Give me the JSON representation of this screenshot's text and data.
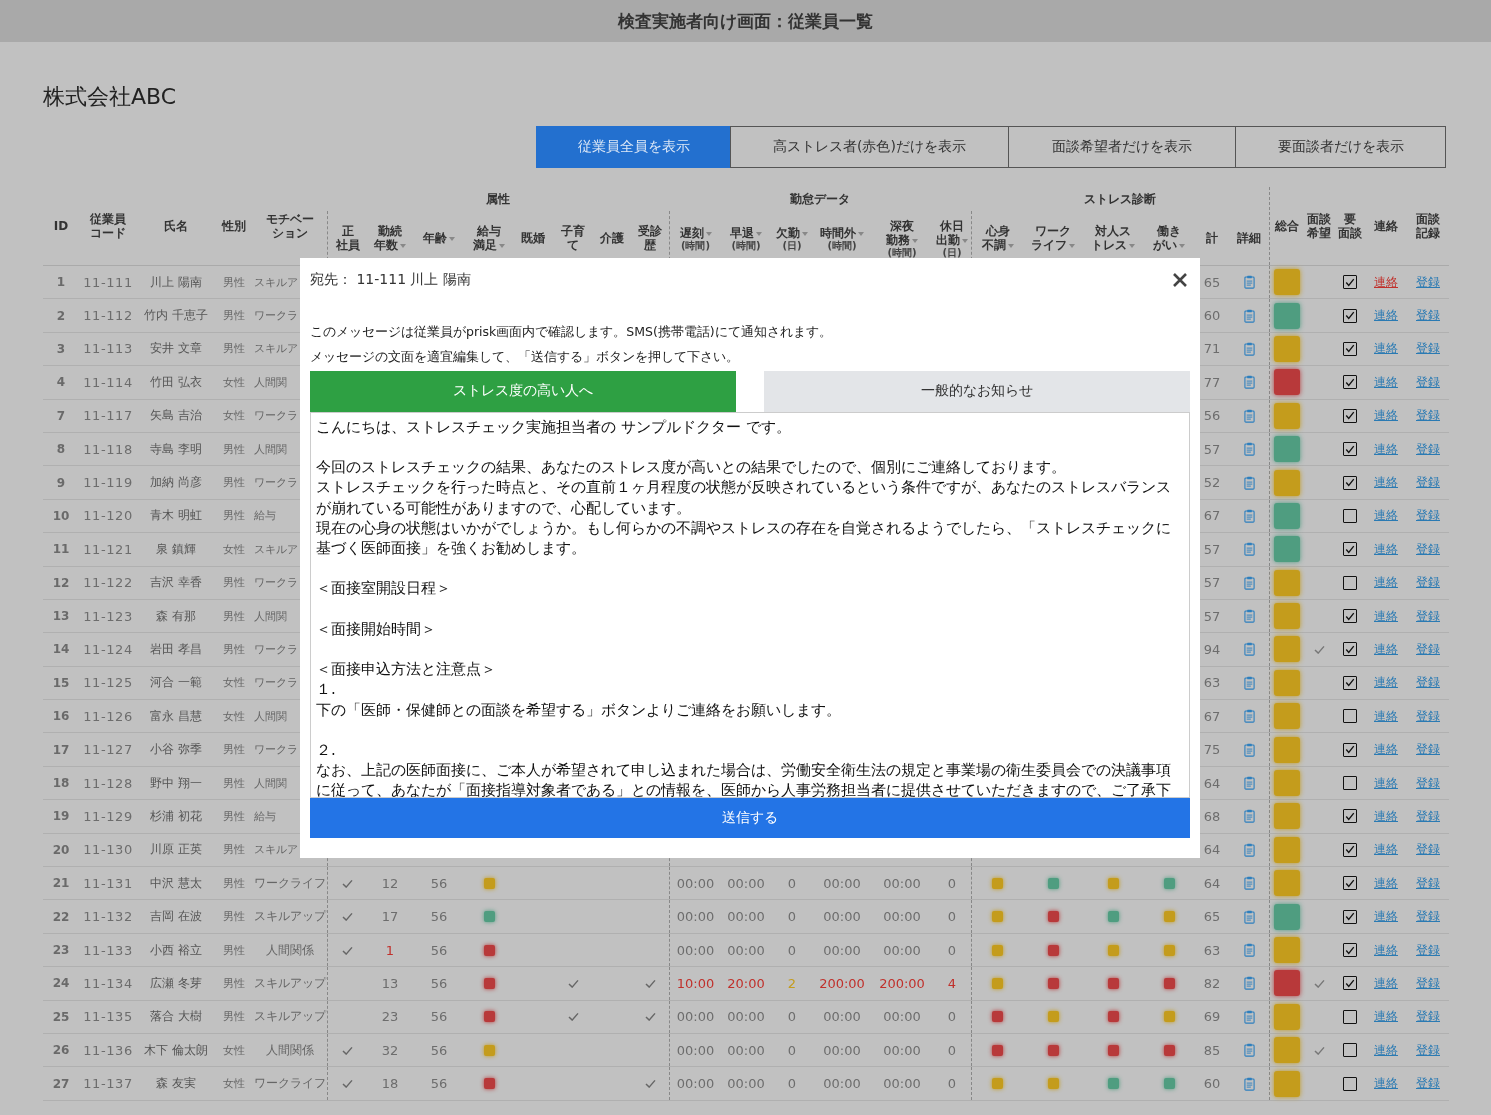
{
  "window": {
    "title": "検査実施者向け画面：従業員一覧"
  },
  "company": "株式会社ABC",
  "filters": [
    {
      "label": "従業員全員を表示",
      "selected": true
    },
    {
      "label": "高ストレス者(赤色)だけを表示",
      "selected": false
    },
    {
      "label": "面談希望者だけを表示",
      "selected": false
    },
    {
      "label": "要面談者だけを表示",
      "selected": false
    }
  ],
  "table": {
    "groups": [
      "属性",
      "勤怠データ",
      "ストレス診断"
    ],
    "columns": [
      {
        "lines": [
          "ID"
        ],
        "sortable": false
      },
      {
        "lines": [
          "従業員",
          "コード"
        ],
        "sortable": false
      },
      {
        "lines": [
          "氏名"
        ],
        "sortable": false
      },
      {
        "lines": [
          "性別"
        ],
        "sortable": false
      },
      {
        "lines": [
          "モチベー",
          "ション"
        ],
        "sortable": false
      },
      {
        "lines": [
          "正",
          "社員"
        ],
        "sortable": false
      },
      {
        "lines": [
          "勤続",
          "年数"
        ],
        "sortable": true
      },
      {
        "lines": [
          "年齢"
        ],
        "sortable": true
      },
      {
        "lines": [
          "給与",
          "満足"
        ],
        "sortable": true
      },
      {
        "lines": [
          "既婚"
        ],
        "sortable": false
      },
      {
        "lines": [
          "子育",
          "て"
        ],
        "sortable": false
      },
      {
        "lines": [
          "介護"
        ],
        "sortable": false
      },
      {
        "lines": [
          "受診",
          "歴"
        ],
        "sortable": false
      },
      {
        "lines": [
          "遅刻"
        ],
        "sortable": true,
        "unit": "(時間)"
      },
      {
        "lines": [
          "早退"
        ],
        "sortable": true,
        "unit": "(時間)"
      },
      {
        "lines": [
          "欠勤"
        ],
        "sortable": true,
        "unit": "(日)"
      },
      {
        "lines": [
          "時間外"
        ],
        "sortable": true,
        "unit": "(時間)"
      },
      {
        "lines": [
          "深夜",
          "勤務"
        ],
        "sortable": true,
        "unit": "(時間)"
      },
      {
        "lines": [
          "休日",
          "出勤"
        ],
        "sortable": true,
        "unit": "(日)"
      },
      {
        "lines": [
          "心身",
          "不調"
        ],
        "sortable": true
      },
      {
        "lines": [
          "ワーク",
          "ライフ"
        ],
        "sortable": true
      },
      {
        "lines": [
          "対人ス",
          "トレス"
        ],
        "sortable": true
      },
      {
        "lines": [
          "働き",
          "がい"
        ],
        "sortable": true
      },
      {
        "lines": [
          "計"
        ],
        "sortable": false
      },
      {
        "lines": [
          "詳細"
        ],
        "sortable": false
      },
      {
        "lines": [
          "総合"
        ],
        "sortable": false
      },
      {
        "lines": [
          "面談",
          "希望"
        ],
        "sortable": false
      },
      {
        "lines": [
          "要",
          "面談"
        ],
        "sortable": false
      },
      {
        "lines": [
          "連絡"
        ],
        "sortable": false
      },
      {
        "lines": [
          "面談",
          "記録"
        ],
        "sortable": false
      }
    ],
    "rows": [
      {
        "id": "1",
        "code": "11-111",
        "name": "川上 陽南",
        "gender": "男性",
        "motivation": "スキルア",
        "total": "65",
        "overall": {
          "color": "#c49c1c"
        },
        "interview_wish": false,
        "interview_needed": true,
        "contact": {
          "label": "連絡",
          "selected": true
        },
        "record": "登録"
      },
      {
        "id": "2",
        "code": "11-112",
        "name": "竹内 千恵子",
        "gender": "男性",
        "motivation": "ワークラ",
        "total": "60",
        "overall": {
          "color": "#4f9d80"
        },
        "interview_wish": false,
        "interview_needed": true,
        "contact": {
          "label": "連絡",
          "selected": false
        },
        "record": "登録"
      },
      {
        "id": "3",
        "code": "11-113",
        "name": "安井 文章",
        "gender": "男性",
        "motivation": "スキルア",
        "total": "71",
        "overall": {
          "color": "#c49c1c"
        },
        "interview_wish": false,
        "interview_needed": true,
        "contact": {
          "label": "連絡",
          "selected": false
        },
        "record": "登録"
      },
      {
        "id": "4",
        "code": "11-114",
        "name": "竹田 弘衣",
        "gender": "女性",
        "motivation": "人間関",
        "total": "77",
        "overall": {
          "color": "#b8393a"
        },
        "interview_wish": false,
        "interview_needed": true,
        "contact": {
          "label": "連絡",
          "selected": false
        },
        "record": "登録"
      },
      {
        "id": "7",
        "code": "11-117",
        "name": "矢島 吉治",
        "gender": "女性",
        "motivation": "ワークラ",
        "total": "56",
        "overall": {
          "color": "#c49c1c"
        },
        "interview_wish": false,
        "interview_needed": true,
        "contact": {
          "label": "連絡",
          "selected": false
        },
        "record": "登録"
      },
      {
        "id": "8",
        "code": "11-118",
        "name": "寺島 李明",
        "gender": "男性",
        "motivation": "人間関",
        "total": "57",
        "overall": {
          "color": "#4f9d80"
        },
        "interview_wish": false,
        "interview_needed": true,
        "contact": {
          "label": "連絡",
          "selected": false
        },
        "record": "登録"
      },
      {
        "id": "9",
        "code": "11-119",
        "name": "加納 尚彦",
        "gender": "男性",
        "motivation": "ワークラ",
        "total": "52",
        "overall": {
          "color": "#c49c1c"
        },
        "interview_wish": false,
        "interview_needed": true,
        "contact": {
          "label": "連絡",
          "selected": false
        },
        "record": "登録"
      },
      {
        "id": "10",
        "code": "11-120",
        "name": "青木 明虹",
        "gender": "男性",
        "motivation": "給与",
        "total": "67",
        "overall": {
          "color": "#4f9d80"
        },
        "interview_wish": false,
        "interview_needed": false,
        "contact": {
          "label": "連絡",
          "selected": false
        },
        "record": "登録"
      },
      {
        "id": "11",
        "code": "11-121",
        "name": "泉 鎮輝",
        "gender": "女性",
        "motivation": "スキルア",
        "total": "57",
        "overall": {
          "color": "#4f9d80"
        },
        "interview_wish": false,
        "interview_needed": true,
        "contact": {
          "label": "連絡",
          "selected": false
        },
        "record": "登録"
      },
      {
        "id": "12",
        "code": "11-122",
        "name": "吉沢 幸香",
        "gender": "男性",
        "motivation": "ワークラ",
        "total": "57",
        "overall": {
          "color": "#c49c1c"
        },
        "interview_wish": false,
        "interview_needed": false,
        "contact": {
          "label": "連絡",
          "selected": false
        },
        "record": "登録"
      },
      {
        "id": "13",
        "code": "11-123",
        "name": "森 有那",
        "gender": "男性",
        "motivation": "人間関",
        "total": "57",
        "overall": {
          "color": "#c49c1c"
        },
        "interview_wish": false,
        "interview_needed": true,
        "contact": {
          "label": "連絡",
          "selected": false
        },
        "record": "登録"
      },
      {
        "id": "14",
        "code": "11-124",
        "name": "岩田 孝昌",
        "gender": "男性",
        "motivation": "ワークラ",
        "total": "94",
        "overall": {
          "color": "#c49c1c"
        },
        "interview_wish": true,
        "interview_needed": true,
        "contact": {
          "label": "連絡",
          "selected": false
        },
        "record": "登録"
      },
      {
        "id": "15",
        "code": "11-125",
        "name": "河合 一範",
        "gender": "女性",
        "motivation": "ワークラ",
        "total": "63",
        "overall": {
          "color": "#c49c1c"
        },
        "interview_wish": false,
        "interview_needed": true,
        "contact": {
          "label": "連絡",
          "selected": false
        },
        "record": "登録"
      },
      {
        "id": "16",
        "code": "11-126",
        "name": "富永 昌慧",
        "gender": "女性",
        "motivation": "人間関",
        "total": "67",
        "overall": {
          "color": "#c49c1c"
        },
        "interview_wish": false,
        "interview_needed": false,
        "contact": {
          "label": "連絡",
          "selected": false
        },
        "record": "登録"
      },
      {
        "id": "17",
        "code": "11-127",
        "name": "小谷 弥季",
        "gender": "男性",
        "motivation": "ワークラ",
        "total": "75",
        "overall": {
          "color": "#c49c1c"
        },
        "interview_wish": false,
        "interview_needed": true,
        "contact": {
          "label": "連絡",
          "selected": false
        },
        "record": "登録"
      },
      {
        "id": "18",
        "code": "11-128",
        "name": "野中 翔一",
        "gender": "男性",
        "motivation": "人間関",
        "total": "64",
        "overall": {
          "color": "#c49c1c"
        },
        "interview_wish": false,
        "interview_needed": false,
        "contact": {
          "label": "連絡",
          "selected": false
        },
        "record": "登録"
      },
      {
        "id": "19",
        "code": "11-129",
        "name": "杉浦 初花",
        "gender": "男性",
        "motivation": "給与",
        "total": "68",
        "overall": {
          "color": "#c49c1c"
        },
        "interview_wish": false,
        "interview_needed": true,
        "contact": {
          "label": "連絡",
          "selected": false
        },
        "record": "登録"
      },
      {
        "id": "20",
        "code": "11-130",
        "name": "川原 正英",
        "gender": "男性",
        "motivation": "スキルア",
        "total": "64",
        "overall": {
          "color": "#c49c1c"
        },
        "interview_wish": false,
        "interview_needed": true,
        "contact": {
          "label": "連絡",
          "selected": false
        },
        "record": "登録"
      },
      {
        "id": "21",
        "code": "11-131",
        "name": "中沢 慧太",
        "gender": "男性",
        "motivation": "ワークライフ",
        "attributes": {
          "full_time": true,
          "tenure": {
            "text": "12",
            "color": "#6d6d6d"
          },
          "age": "56",
          "salary": {
            "color": "#c49c1c"
          },
          "married": false,
          "childcare": false,
          "care": false,
          "checkup": false
        },
        "attendance": [
          {
            "text": "00:00",
            "color": "#6d6d6d"
          },
          {
            "text": "00:00",
            "color": "#6d6d6d"
          },
          {
            "text": "0",
            "color": "#6d6d6d"
          },
          {
            "text": "00:00",
            "color": "#6d6d6d"
          },
          {
            "text": "00:00",
            "color": "#6d6d6d"
          },
          {
            "text": "0",
            "color": "#6d6d6d"
          }
        ],
        "stress": [
          {
            "color": "#c49c1c"
          },
          {
            "color": "#4f9d80"
          },
          {
            "color": "#c49c1c"
          },
          {
            "color": "#4f9d80"
          }
        ],
        "total": "64",
        "overall": {
          "color": "#c49c1c"
        },
        "interview_wish": false,
        "interview_needed": true,
        "contact": {
          "label": "連絡",
          "selected": false
        },
        "record": "登録"
      },
      {
        "id": "22",
        "code": "11-132",
        "name": "吉岡 在波",
        "gender": "男性",
        "motivation": "スキルアップ",
        "attributes": {
          "full_time": true,
          "tenure": {
            "text": "17",
            "color": "#6d6d6d"
          },
          "age": "56",
          "salary": {
            "color": "#4f9d80"
          },
          "married": false,
          "childcare": false,
          "care": false,
          "checkup": false
        },
        "attendance": [
          {
            "text": "00:00",
            "color": "#6d6d6d"
          },
          {
            "text": "00:00",
            "color": "#6d6d6d"
          },
          {
            "text": "0",
            "color": "#6d6d6d"
          },
          {
            "text": "00:00",
            "color": "#6d6d6d"
          },
          {
            "text": "00:00",
            "color": "#6d6d6d"
          },
          {
            "text": "0",
            "color": "#6d6d6d"
          }
        ],
        "stress": [
          {
            "color": "#c49c1c"
          },
          {
            "color": "#b8393a"
          },
          {
            "color": "#4f9d80"
          },
          {
            "color": "#c49c1c"
          }
        ],
        "total": "65",
        "overall": {
          "color": "#4f9d80"
        },
        "interview_wish": false,
        "interview_needed": true,
        "contact": {
          "label": "連絡",
          "selected": false
        },
        "record": "登録"
      },
      {
        "id": "23",
        "code": "11-133",
        "name": "小西 裕立",
        "gender": "男性",
        "motivation": "人間関係",
        "attributes": {
          "full_time": true,
          "tenure": {
            "text": "1",
            "color": "#c0302b"
          },
          "age": "56",
          "salary": {
            "color": "#b8393a"
          },
          "married": false,
          "childcare": false,
          "care": false,
          "checkup": false
        },
        "attendance": [
          {
            "text": "00:00",
            "color": "#6d6d6d"
          },
          {
            "text": "00:00",
            "color": "#6d6d6d"
          },
          {
            "text": "0",
            "color": "#6d6d6d"
          },
          {
            "text": "00:00",
            "color": "#6d6d6d"
          },
          {
            "text": "00:00",
            "color": "#6d6d6d"
          },
          {
            "text": "0",
            "color": "#6d6d6d"
          }
        ],
        "stress": [
          {
            "color": "#c49c1c"
          },
          {
            "color": "#b8393a"
          },
          {
            "color": "#c49c1c"
          },
          {
            "color": "#c49c1c"
          }
        ],
        "total": "63",
        "overall": {
          "color": "#c49c1c"
        },
        "interview_wish": false,
        "interview_needed": true,
        "contact": {
          "label": "連絡",
          "selected": false
        },
        "record": "登録"
      },
      {
        "id": "24",
        "code": "11-134",
        "name": "広瀬 冬芽",
        "gender": "男性",
        "motivation": "スキルアップ",
        "attributes": {
          "full_time": false,
          "tenure": {
            "text": "13",
            "color": "#6d6d6d"
          },
          "age": "56",
          "salary": {
            "color": "#b8393a"
          },
          "married": false,
          "childcare": true,
          "care": false,
          "checkup": true
        },
        "attendance": [
          {
            "text": "10:00",
            "color": "#c0302b"
          },
          {
            "text": "20:00",
            "color": "#c0302b"
          },
          {
            "text": "2",
            "color": "#c49c1c"
          },
          {
            "text": "200:00",
            "color": "#c0302b"
          },
          {
            "text": "200:00",
            "color": "#c0302b"
          },
          {
            "text": "4",
            "color": "#c0302b"
          }
        ],
        "stress": [
          {
            "color": "#c49c1c"
          },
          {
            "color": "#b8393a"
          },
          {
            "color": "#b8393a"
          },
          {
            "color": "#b8393a"
          }
        ],
        "total": "82",
        "overall": {
          "color": "#b8393a"
        },
        "interview_wish": true,
        "interview_needed": true,
        "contact": {
          "label": "連絡",
          "selected": false
        },
        "record": "登録"
      },
      {
        "id": "25",
        "code": "11-135",
        "name": "落合 大樹",
        "gender": "男性",
        "motivation": "スキルアップ",
        "attributes": {
          "full_time": false,
          "tenure": {
            "text": "23",
            "color": "#6d6d6d"
          },
          "age": "56",
          "salary": {
            "color": "#b8393a"
          },
          "married": false,
          "childcare": true,
          "care": false,
          "checkup": true
        },
        "attendance": [
          {
            "text": "00:00",
            "color": "#6d6d6d"
          },
          {
            "text": "00:00",
            "color": "#6d6d6d"
          },
          {
            "text": "0",
            "color": "#6d6d6d"
          },
          {
            "text": "00:00",
            "color": "#6d6d6d"
          },
          {
            "text": "00:00",
            "color": "#6d6d6d"
          },
          {
            "text": "0",
            "color": "#6d6d6d"
          }
        ],
        "stress": [
          {
            "color": "#b8393a"
          },
          {
            "color": "#c49c1c"
          },
          {
            "color": "#b8393a"
          },
          {
            "color": "#c49c1c"
          }
        ],
        "total": "69",
        "overall": {
          "color": "#c49c1c"
        },
        "interview_wish": false,
        "interview_needed": false,
        "contact": {
          "label": "連絡",
          "selected": false
        },
        "record": "登録"
      },
      {
        "id": "26",
        "code": "11-136",
        "name": "木下 倫太朗",
        "gender": "女性",
        "motivation": "人間関係",
        "attributes": {
          "full_time": true,
          "tenure": {
            "text": "32",
            "color": "#6d6d6d"
          },
          "age": "56",
          "salary": {
            "color": "#c49c1c"
          },
          "married": false,
          "childcare": false,
          "care": false,
          "checkup": false
        },
        "attendance": [
          {
            "text": "00:00",
            "color": "#6d6d6d"
          },
          {
            "text": "00:00",
            "color": "#6d6d6d"
          },
          {
            "text": "0",
            "color": "#6d6d6d"
          },
          {
            "text": "00:00",
            "color": "#6d6d6d"
          },
          {
            "text": "00:00",
            "color": "#6d6d6d"
          },
          {
            "text": "0",
            "color": "#6d6d6d"
          }
        ],
        "stress": [
          {
            "color": "#b8393a"
          },
          {
            "color": "#b8393a"
          },
          {
            "color": "#b8393a"
          },
          {
            "color": "#b8393a"
          }
        ],
        "total": "85",
        "overall": {
          "color": "#c49c1c"
        },
        "interview_wish": true,
        "interview_needed": false,
        "contact": {
          "label": "連絡",
          "selected": false
        },
        "record": "登録"
      },
      {
        "id": "27",
        "code": "11-137",
        "name": "森 友実",
        "gender": "女性",
        "motivation": "ワークライフ",
        "attributes": {
          "full_time": true,
          "tenure": {
            "text": "18",
            "color": "#6d6d6d"
          },
          "age": "56",
          "salary": {
            "color": "#b8393a"
          },
          "married": false,
          "childcare": false,
          "care": false,
          "checkup": true
        },
        "attendance": [
          {
            "text": "00:00",
            "color": "#6d6d6d"
          },
          {
            "text": "00:00",
            "color": "#6d6d6d"
          },
          {
            "text": "0",
            "color": "#6d6d6d"
          },
          {
            "text": "00:00",
            "color": "#6d6d6d"
          },
          {
            "text": "00:00",
            "color": "#6d6d6d"
          },
          {
            "text": "0",
            "color": "#6d6d6d"
          }
        ],
        "stress": [
          {
            "color": "#c49c1c"
          },
          {
            "color": "#c49c1c"
          },
          {
            "color": "#4f9d80"
          },
          {
            "color": "#4f9d80"
          }
        ],
        "total": "60",
        "overall": {
          "color": "#c49c1c"
        },
        "interview_wish": false,
        "interview_needed": false,
        "contact": {
          "label": "連絡",
          "selected": false
        },
        "record": "登録"
      }
    ]
  },
  "dialog": {
    "recipient": "宛先： 11-111 川上 陽南",
    "notes": [
      "このメッセージは従業員がprisk画面内で確認します。SMS(携帯電話)にて通知されます。",
      "メッセージの文面を適宜編集して、「送信する」ボタンを押して下さい。"
    ],
    "tabs": [
      {
        "label": "ストレス度の高い人へ",
        "selected": true
      },
      {
        "label": "一般的なお知らせ",
        "selected": false
      }
    ],
    "message": [
      [
        "こんにちは、ストレスチェック実施担当者の サンプルドクター です。"
      ],
      [
        "今回のストレスチェックの結果、あなたのストレス度が高いとの結果でしたので、個別にご連絡しております。",
        "ストレスチェックを行った時点と、その直前１ヶ月程度の状態が反映されているという条件ですが、あなたのストレスバランスが崩れている可能性がありますので、心配しています。",
        "現在の心身の状態はいかがでしょうか。もし何らかの不調やストレスの存在を自覚されるようでしたら、「ストレスチェックに基づく医師面接」を強くお勧めします。"
      ],
      [
        "＜面接室開設日程＞"
      ],
      [
        "＜面接開始時間＞"
      ],
      [
        "＜面接申込方法と注意点＞",
        "１.",
        "下の「医師・保健師との面談を希望する」ボタンよりご連絡をお願いします。"
      ],
      [
        "２.",
        "なお、上記の医師面接に、ご本人が希望されて申し込まれた場合は、労働安全衛生法の規定と事業場の衛生委員会での決議事項に従って、あなたが「面接指導対象者である」との情報を、医師から人事労務担当者に提供させていただきますので、ご了承下"
      ]
    ],
    "send": "送信する"
  }
}
